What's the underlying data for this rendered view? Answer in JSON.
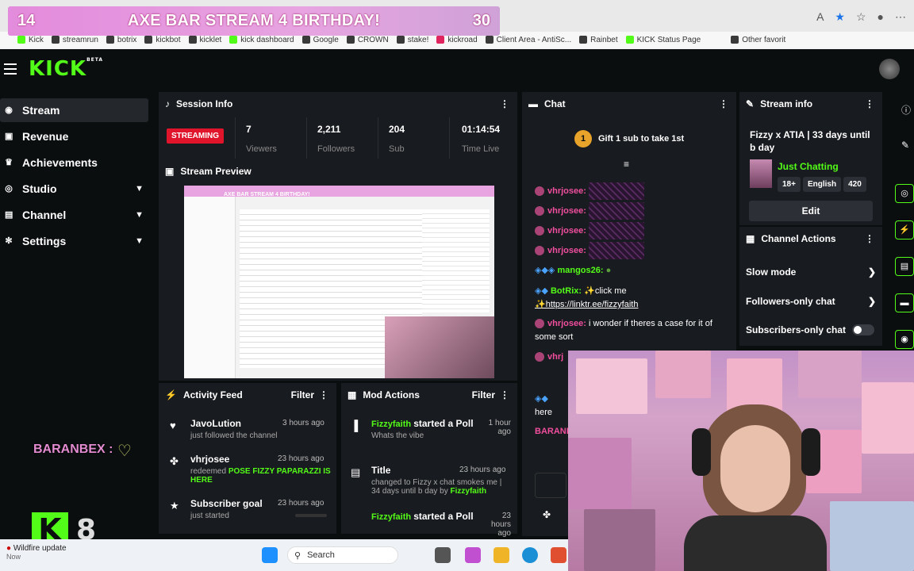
{
  "banner": {
    "left_num": "14",
    "title": "AXE BAR STREAM 4 BIRTHDAY!",
    "right_num": "30"
  },
  "bookmarks": [
    "Kick",
    "streamrun",
    "botrix",
    "kickbot",
    "kicklet",
    "kick dashboard",
    "Google",
    "CROWN",
    "stake!",
    "kickroad",
    "Client Area - AntiSc...",
    "Rainbet",
    "KICK Status Page",
    "Other favorit"
  ],
  "logo": "KICK",
  "logo_sup": "BETA",
  "sidebar": {
    "items": [
      {
        "label": "Stream",
        "icon": "stream-icon"
      },
      {
        "label": "Revenue",
        "icon": "revenue-icon"
      },
      {
        "label": "Achievements",
        "icon": "trophy-icon"
      },
      {
        "label": "Studio",
        "icon": "globe-icon"
      },
      {
        "label": "Channel",
        "icon": "channel-icon"
      },
      {
        "label": "Settings",
        "icon": "gear-icon"
      }
    ]
  },
  "overlay": {
    "user": "BARANBEX",
    "colon": ":",
    "sticker_num": "8"
  },
  "session": {
    "title": "Session Info",
    "status": "STREAMING",
    "stats": [
      {
        "value": "7",
        "label": "Viewers"
      },
      {
        "value": "2,211",
        "label": "Followers"
      },
      {
        "value": "204",
        "label": "Sub"
      },
      {
        "value": "01:14:54",
        "label": "Time Live"
      }
    ]
  },
  "preview": {
    "title": "Stream Preview",
    "inner_banner": "AXE BAR STREAM 4 BIRTHDAY!"
  },
  "activity": {
    "title": "Activity Feed",
    "filter": "Filter",
    "items": [
      {
        "name": "JavoLution",
        "time": "3 hours ago",
        "text": "just followed the channel"
      },
      {
        "name": "vhrjosee",
        "time": "23 hours ago",
        "text": "redeemed",
        "reward": "POSE FIZZY PAPARAZZI IS HERE"
      },
      {
        "name": "Subscriber goal",
        "time": "23 hours ago",
        "text": "just started"
      }
    ]
  },
  "mod": {
    "title": "Mod Actions",
    "filter": "Filter",
    "items": [
      {
        "name": "Fizzyfaith",
        "action": "started a Poll",
        "time": "1 hour ago",
        "sub": "Whats the vibe"
      },
      {
        "name": "Title",
        "time": "23 hours ago",
        "sub": "changed to Fizzy x chat smokes me | 34 days until b day",
        "by": "by",
        "by_name": "Fizzyfaith"
      },
      {
        "name": "Fizzyfaith",
        "action": "started a Poll",
        "time": "23 hours ago"
      }
    ]
  },
  "chat": {
    "title": "Chat",
    "gift": "Gift 1 sub to take 1st",
    "gift_coin": "1",
    "lines": [
      {
        "user": "vhrjosee:"
      },
      {
        "user": "vhrjosee:"
      },
      {
        "user": "vhrjosee:"
      },
      {
        "user": "vhrjosee:"
      },
      {
        "user": "mangos26:"
      }
    ],
    "botrix_user": "BotRix:",
    "botrix_msg": "✨click me",
    "botrix_link": "✨https://linktr.ee/fizzyfaith",
    "msg_user": "vhrjosee:",
    "msg_text": "i wonder if theres a case for it of",
    "msg_text2": "some sort",
    "last_user": "vhrj",
    "partial_here": "here",
    "partial_baran": "BARANE"
  },
  "stream_info": {
    "title": "Stream info",
    "stream_title": "Fizzy x ATIA | 33 days until b day",
    "category": "Just Chatting",
    "tags": [
      "18+",
      "English",
      "420"
    ],
    "edit": "Edit"
  },
  "channel_actions": {
    "title": "Channel Actions",
    "options": [
      "Slow mode",
      "Followers-only chat",
      "Subscribers-only chat"
    ]
  },
  "taskbar": {
    "notice_title": "Wildfire update",
    "notice_time": "Now",
    "search": "Search"
  },
  "colors": {
    "kick_green": "#53fc18",
    "streaming_red": "#e0152b",
    "banner_pink": "#e38bdc"
  }
}
